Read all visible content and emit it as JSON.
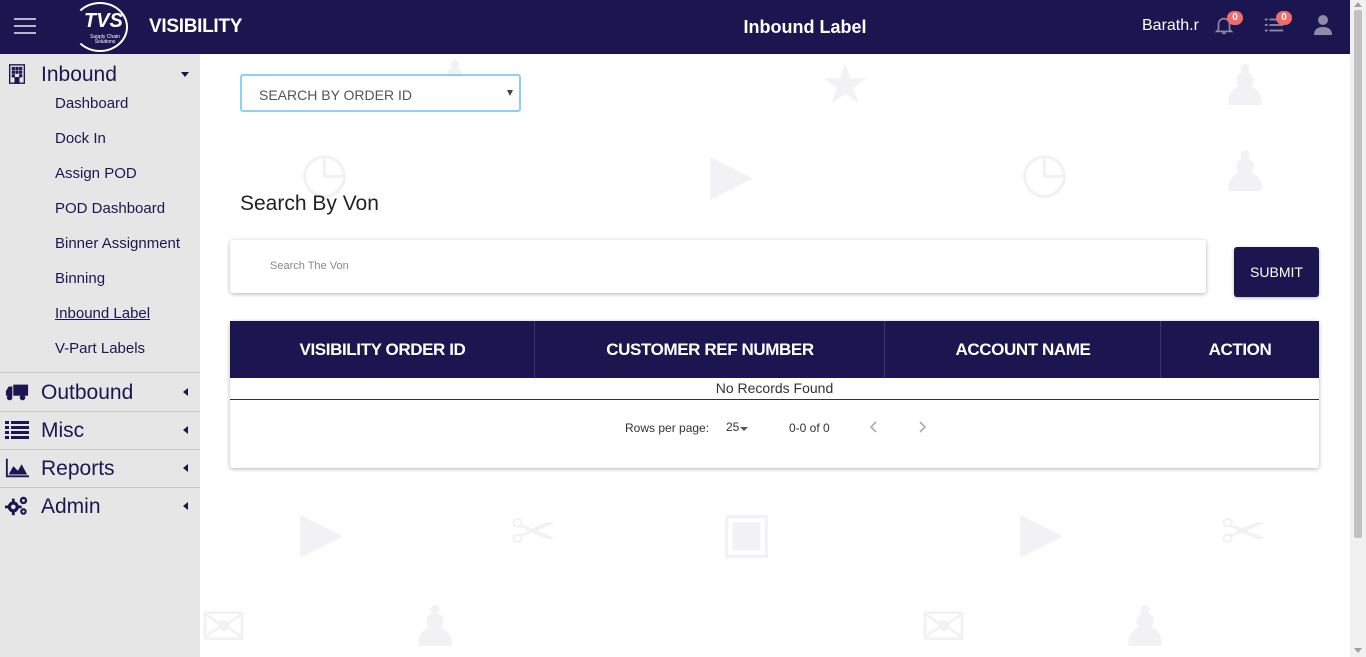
{
  "header": {
    "brand": "VISIBILITY",
    "logo_text": "TVS",
    "logo_sub": "Supply Chain Solutions",
    "title": "Inbound Label",
    "username": "Barath.r",
    "notifications_count": "0",
    "tasks_count": "0",
    "bg_color": "#1c1650"
  },
  "sidebar": {
    "inbound": {
      "label": "Inbound",
      "icon": "building-icon",
      "items": [
        {
          "label": "Dashboard"
        },
        {
          "label": "Dock In"
        },
        {
          "label": "Assign POD"
        },
        {
          "label": "POD Dashboard"
        },
        {
          "label": "Binner Assignment"
        },
        {
          "label": "Binning"
        },
        {
          "label": "Inbound Label",
          "active": true
        },
        {
          "label": "V-Part Labels"
        }
      ]
    },
    "outbound": {
      "label": "Outbound",
      "icon": "truck-icon"
    },
    "misc": {
      "label": "Misc",
      "icon": "list-icon"
    },
    "reports": {
      "label": "Reports",
      "icon": "area-chart-icon"
    },
    "admin": {
      "label": "Admin",
      "icon": "cogs-icon"
    }
  },
  "main": {
    "order_select": {
      "value": "SEARCH BY ORDER ID"
    },
    "von_title": "Search By Von",
    "von_input": {
      "placeholder": "Search The Von",
      "value": ""
    },
    "submit_label": "SUBMIT",
    "table": {
      "columns": [
        "VISIBILITY ORDER ID",
        "CUSTOMER REF NUMBER",
        "ACCOUNT NAME",
        "ACTION"
      ],
      "rows": [],
      "empty_text": "No Records Found"
    },
    "pagination": {
      "rows_per_page_label": "Rows per page:",
      "rows_per_page": "25",
      "range": "0-0 of 0"
    }
  }
}
